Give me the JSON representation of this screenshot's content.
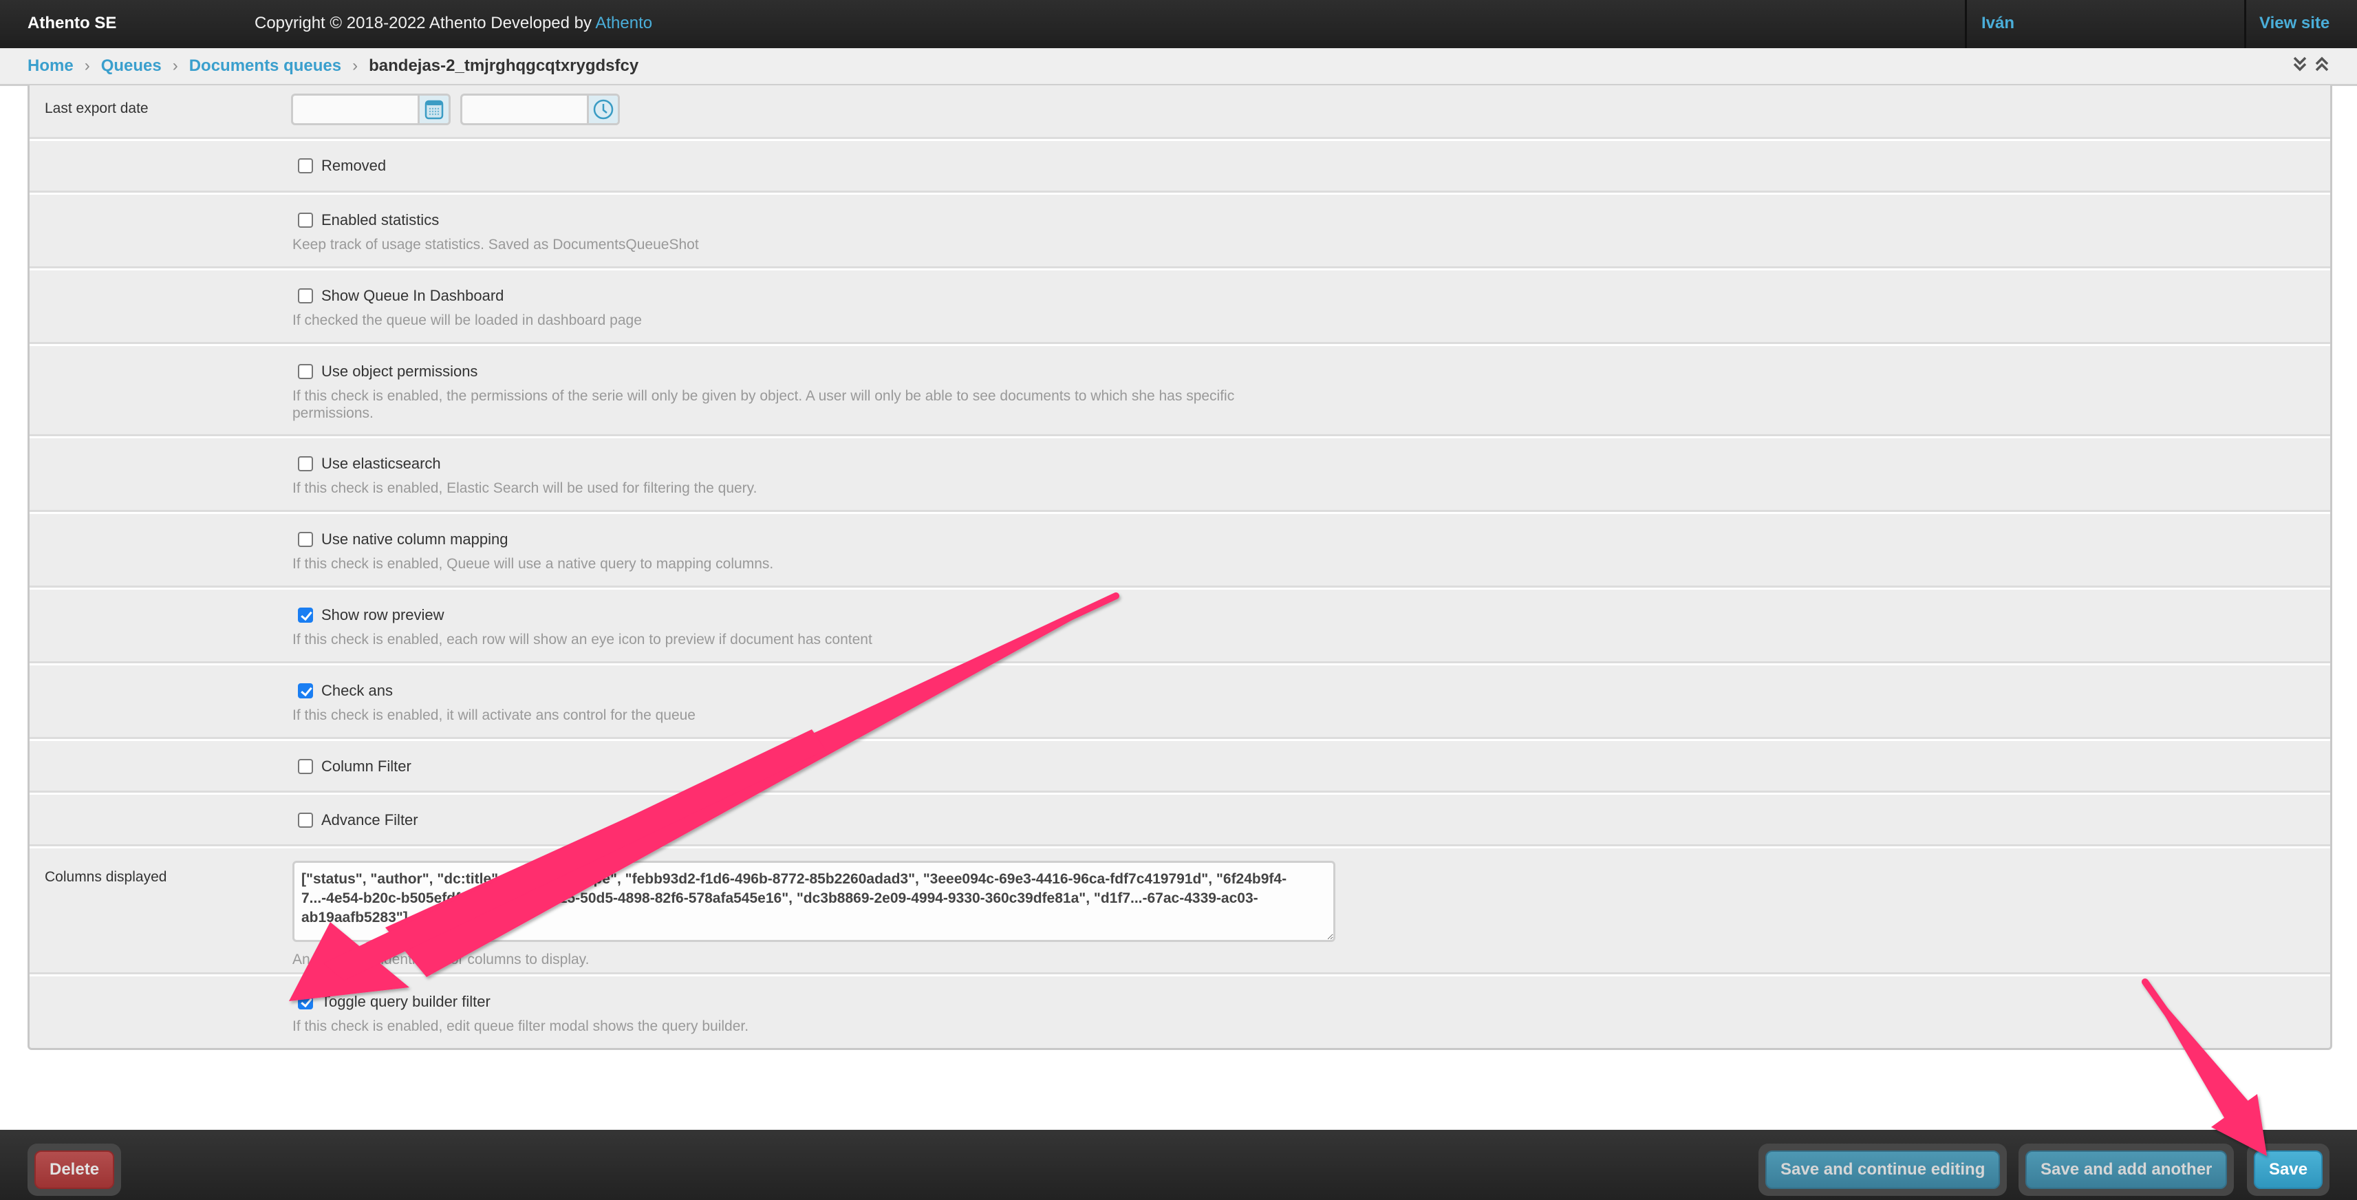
{
  "header": {
    "brand": "Athento SE",
    "copyright_prefix": "Copyright © 2018-2022 Athento Developed by ",
    "copyright_link": "Athento",
    "user": "Iván",
    "view_site": "View site"
  },
  "breadcrumb": {
    "items": [
      "Home",
      "Queues",
      "Documents queues"
    ],
    "current": "bandejas-2_tmjrghqgcqtxrygdsfcy",
    "separator": "›"
  },
  "form": {
    "last_export_date": {
      "label": "Last export date",
      "date_value": "",
      "time_value": ""
    },
    "checkboxes": [
      {
        "label": "Removed",
        "checked": false,
        "help": ""
      },
      {
        "label": "Enabled statistics",
        "checked": false,
        "help": "Keep track of usage statistics. Saved as DocumentsQueueShot"
      },
      {
        "label": "Show Queue In Dashboard",
        "checked": false,
        "help": "If checked the queue will be loaded in dashboard page"
      },
      {
        "label": "Use object permissions",
        "checked": false,
        "help": "If this check is enabled, the permissions of the serie will only be given by object. A user will only be able to see documents to which she has specific permissions."
      },
      {
        "label": "Use elasticsearch",
        "checked": false,
        "help": "If this check is enabled, Elastic Search will be used for filtering the query."
      },
      {
        "label": "Use native column mapping",
        "checked": false,
        "help": "If this check is enabled, Queue will use a native query to mapping columns."
      },
      {
        "label": "Show row preview",
        "checked": true,
        "help": "If this check is enabled, each row will show an eye icon to preview if document has content"
      },
      {
        "label": "Check ans",
        "checked": true,
        "help": "If this check is enabled, it will activate ans control for the queue"
      },
      {
        "label": "Column Filter",
        "checked": false,
        "help": ""
      },
      {
        "label": "Advance Filter",
        "checked": false,
        "help": ""
      }
    ],
    "columns_displayed": {
      "label": "Columns displayed",
      "value": "[\"status\", \"author\", \"dc:title\", \"s...\", \"doctype\", \"febb93d2-f1d6-496b-8772-85b2260adad3\", \"3eee094c-69e3-4416-96ca-fdf7c419791d\", \"6f24b9f4-7...-4e54-b20c-b505efdf9467\", \"0e3f6815-50d5-4898-82f6-578afa545e16\", \"dc3b8869-2e09-4994-9330-360c39dfe81a\", \"d1f7...-67ac-4339-ac03-ab19aafb5283\"]",
      "help": "An array with identifiers for columns to display."
    },
    "toggle_query_builder": {
      "label": "Toggle query builder filter",
      "checked": true,
      "help": "If this check is enabled, edit queue filter modal shows the query builder."
    }
  },
  "footer": {
    "delete": "Delete",
    "save_continue": "Save and continue editing",
    "save_add": "Save and add another",
    "save": "Save"
  },
  "colors": {
    "link": "#3a9fcd",
    "checkbox_checked": "#1a7ef2",
    "delete": "#a83c3c",
    "save": "#3ea5cb",
    "annotation_arrow": "#ff2d6e"
  }
}
